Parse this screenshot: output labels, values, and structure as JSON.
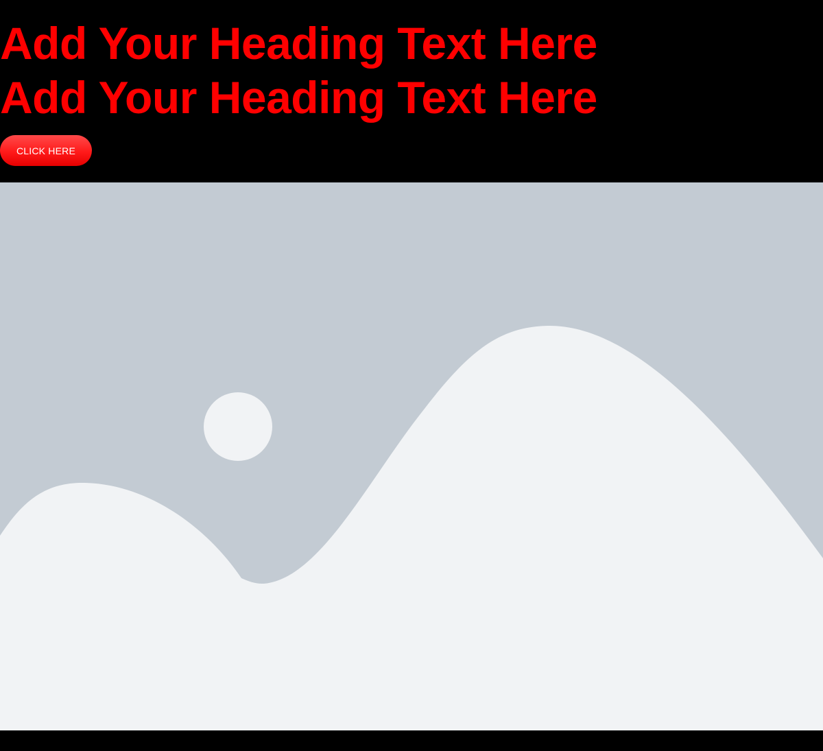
{
  "hero": {
    "heading_1": "Add Your Heading Text Here",
    "heading_2": "Add Your Heading Text Here",
    "button_label": "CLICK HERE"
  },
  "image_placeholder": {
    "icon": "image-placeholder-icon"
  },
  "colors": {
    "background": "#000000",
    "heading": "#ff0000",
    "button": "#ff1a1a",
    "placeholder_back": "#c3cbd3",
    "placeholder_front": "#f1f3f5"
  }
}
